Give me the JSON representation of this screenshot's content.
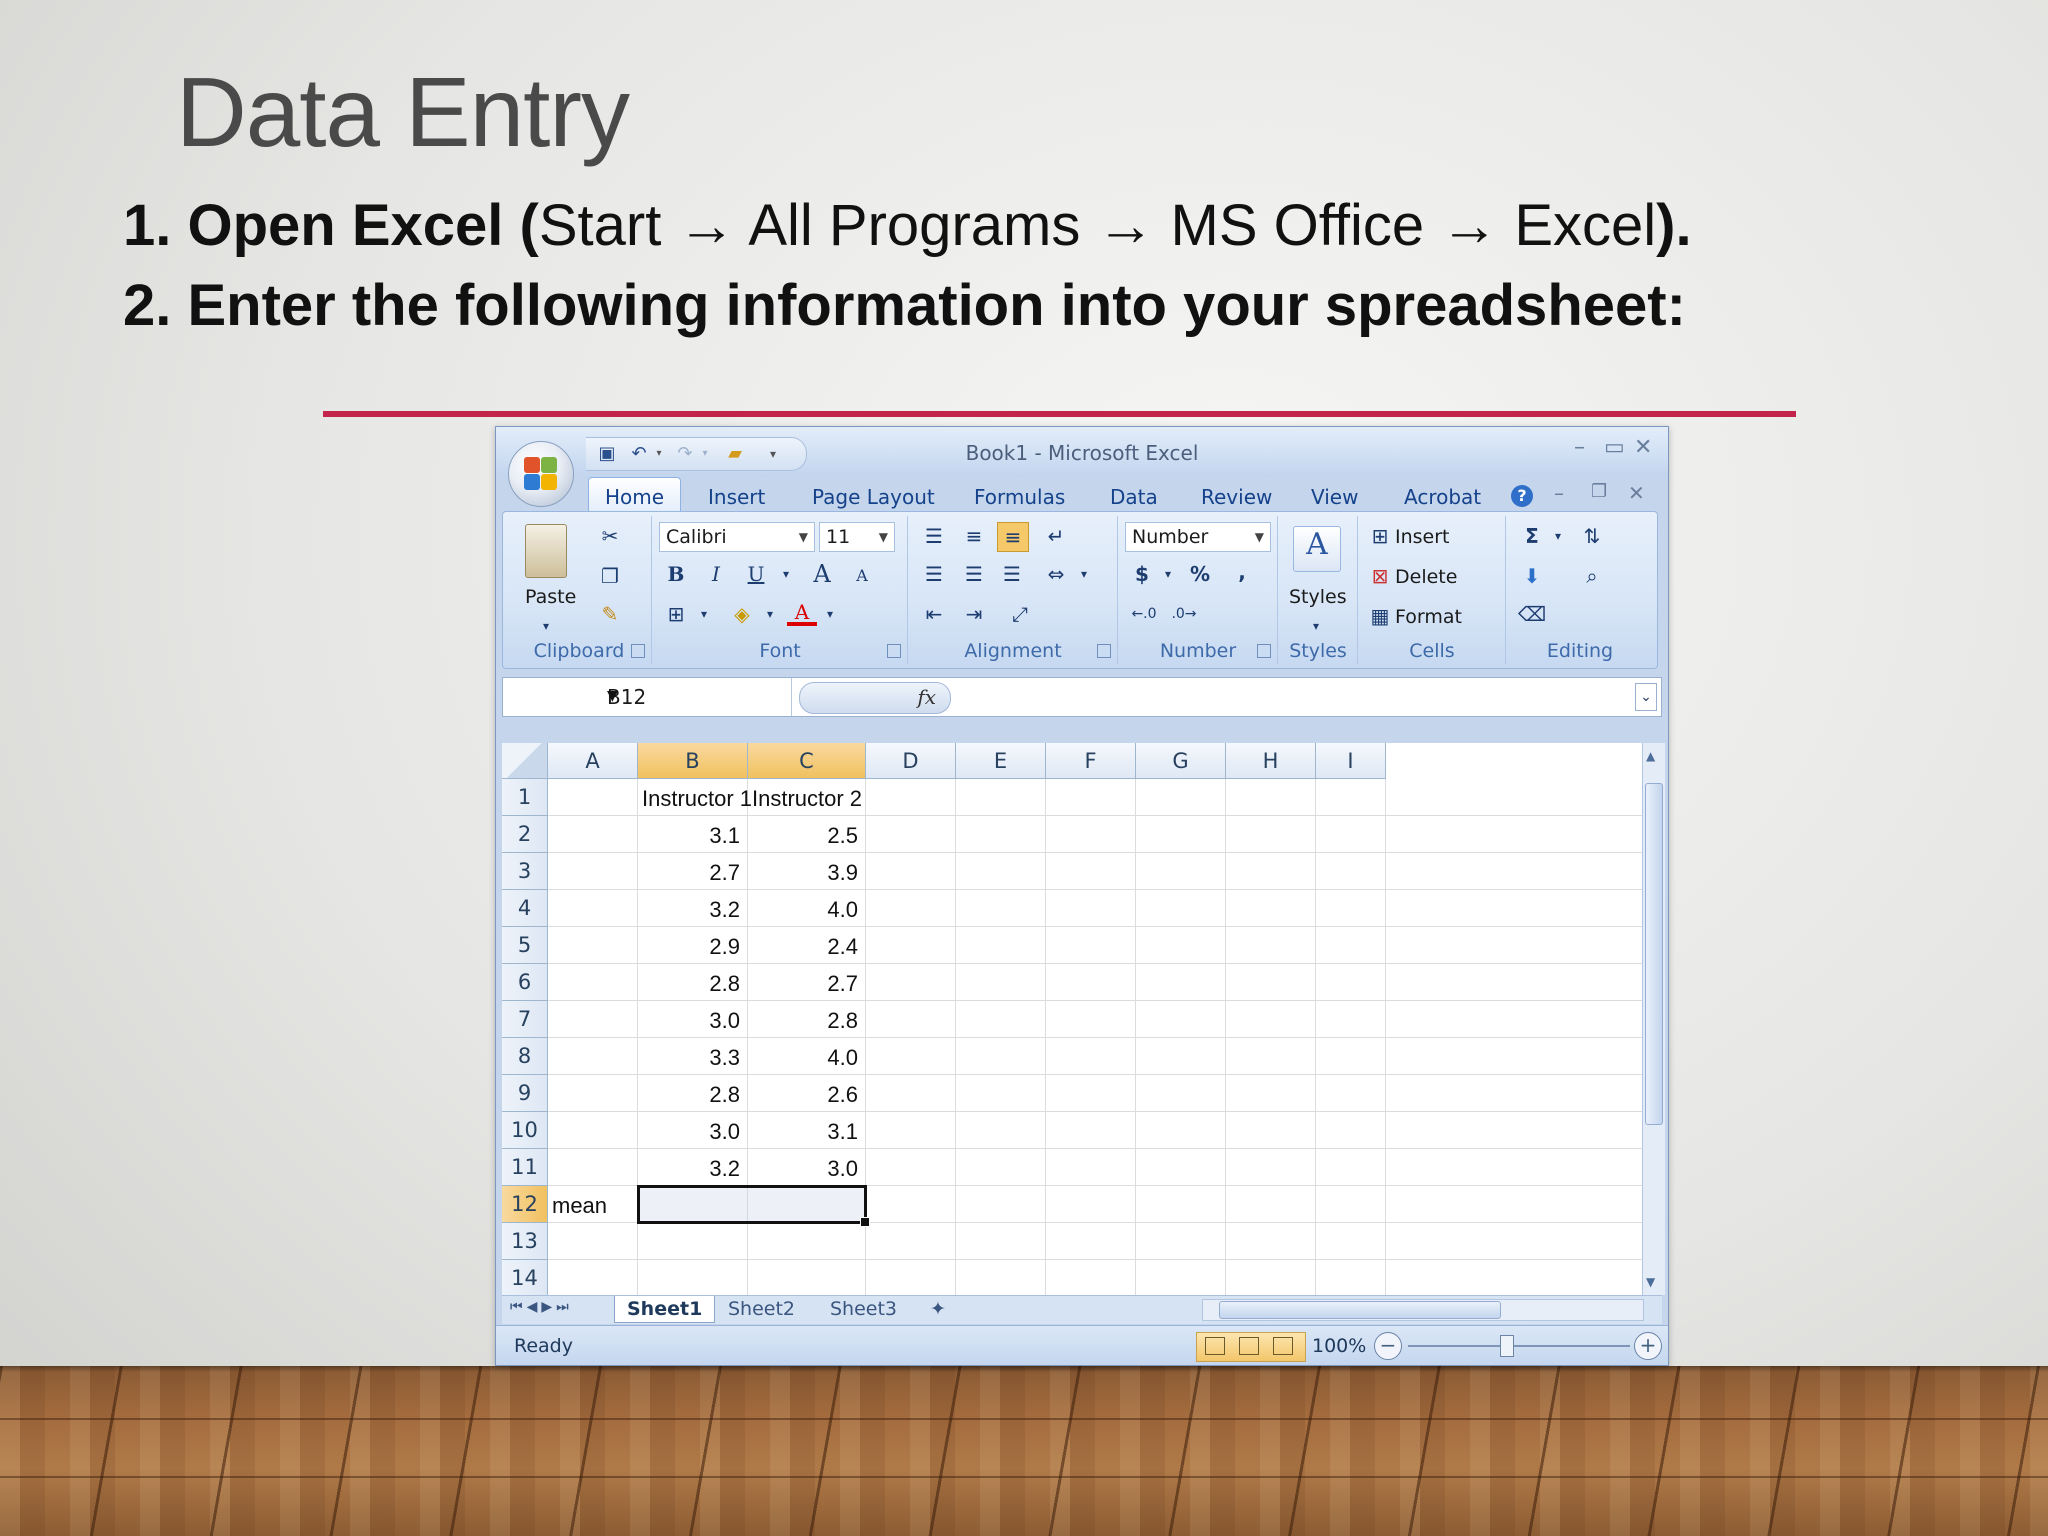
{
  "slide": {
    "title": "Data Entry",
    "step1": {
      "num": "1.",
      "bold_start": "Open Excel (",
      "plain": "Start → All Programs → MS Office → Excel",
      "bold_end": ")."
    },
    "step2": "2. Enter the following information into your spreadsheet:",
    "accent_color": "#c2244a"
  },
  "excel": {
    "window_title": "Book1 - Microsoft Excel",
    "tabs": [
      "Home",
      "Insert",
      "Page Layout",
      "Formulas",
      "Data",
      "Review",
      "View",
      "Acrobat"
    ],
    "active_tab": "Home",
    "ribbon": {
      "clipboard": {
        "label": "Clipboard",
        "paste": "Paste"
      },
      "font": {
        "label": "Font",
        "family": "Calibri",
        "size": "11",
        "bold": "B",
        "italic": "I",
        "underline": "U",
        "grow": "A",
        "shrink": "A"
      },
      "alignment": {
        "label": "Alignment"
      },
      "number": {
        "label": "Number",
        "format": "Number",
        "currency": "$",
        "percent": "%",
        "comma": ","
      },
      "styles": {
        "label": "Styles"
      },
      "cells": {
        "label": "Cells",
        "insert": "Insert",
        "delete": "Delete",
        "format": "Format"
      },
      "editing": {
        "label": "Editing"
      }
    },
    "name_box": "B12",
    "fx": "fx",
    "columns": [
      "A",
      "B",
      "C",
      "D",
      "E",
      "F",
      "G",
      "H",
      "I"
    ],
    "rows": [
      "1",
      "2",
      "3",
      "4",
      "5",
      "6",
      "7",
      "8",
      "9",
      "10",
      "11",
      "12",
      "13",
      "14"
    ],
    "selected_columns": [
      "B",
      "C"
    ],
    "selected_row": "12",
    "cells": {
      "B1": "Instructor 1",
      "C1": "Instructor 2",
      "instructor1": [
        "3.1",
        "2.7",
        "3.2",
        "2.9",
        "2.8",
        "3.0",
        "3.3",
        "2.8",
        "3.0",
        "3.2"
      ],
      "instructor2": [
        "2.5",
        "3.9",
        "4.0",
        "2.4",
        "2.7",
        "2.8",
        "4.0",
        "2.6",
        "3.1",
        "3.0"
      ],
      "A12": "mean"
    },
    "sheets": [
      "Sheet1",
      "Sheet2",
      "Sheet3"
    ],
    "active_sheet": "Sheet1",
    "status": "Ready",
    "zoom": "100%",
    "zoom_minus": "−",
    "zoom_plus": "+"
  }
}
